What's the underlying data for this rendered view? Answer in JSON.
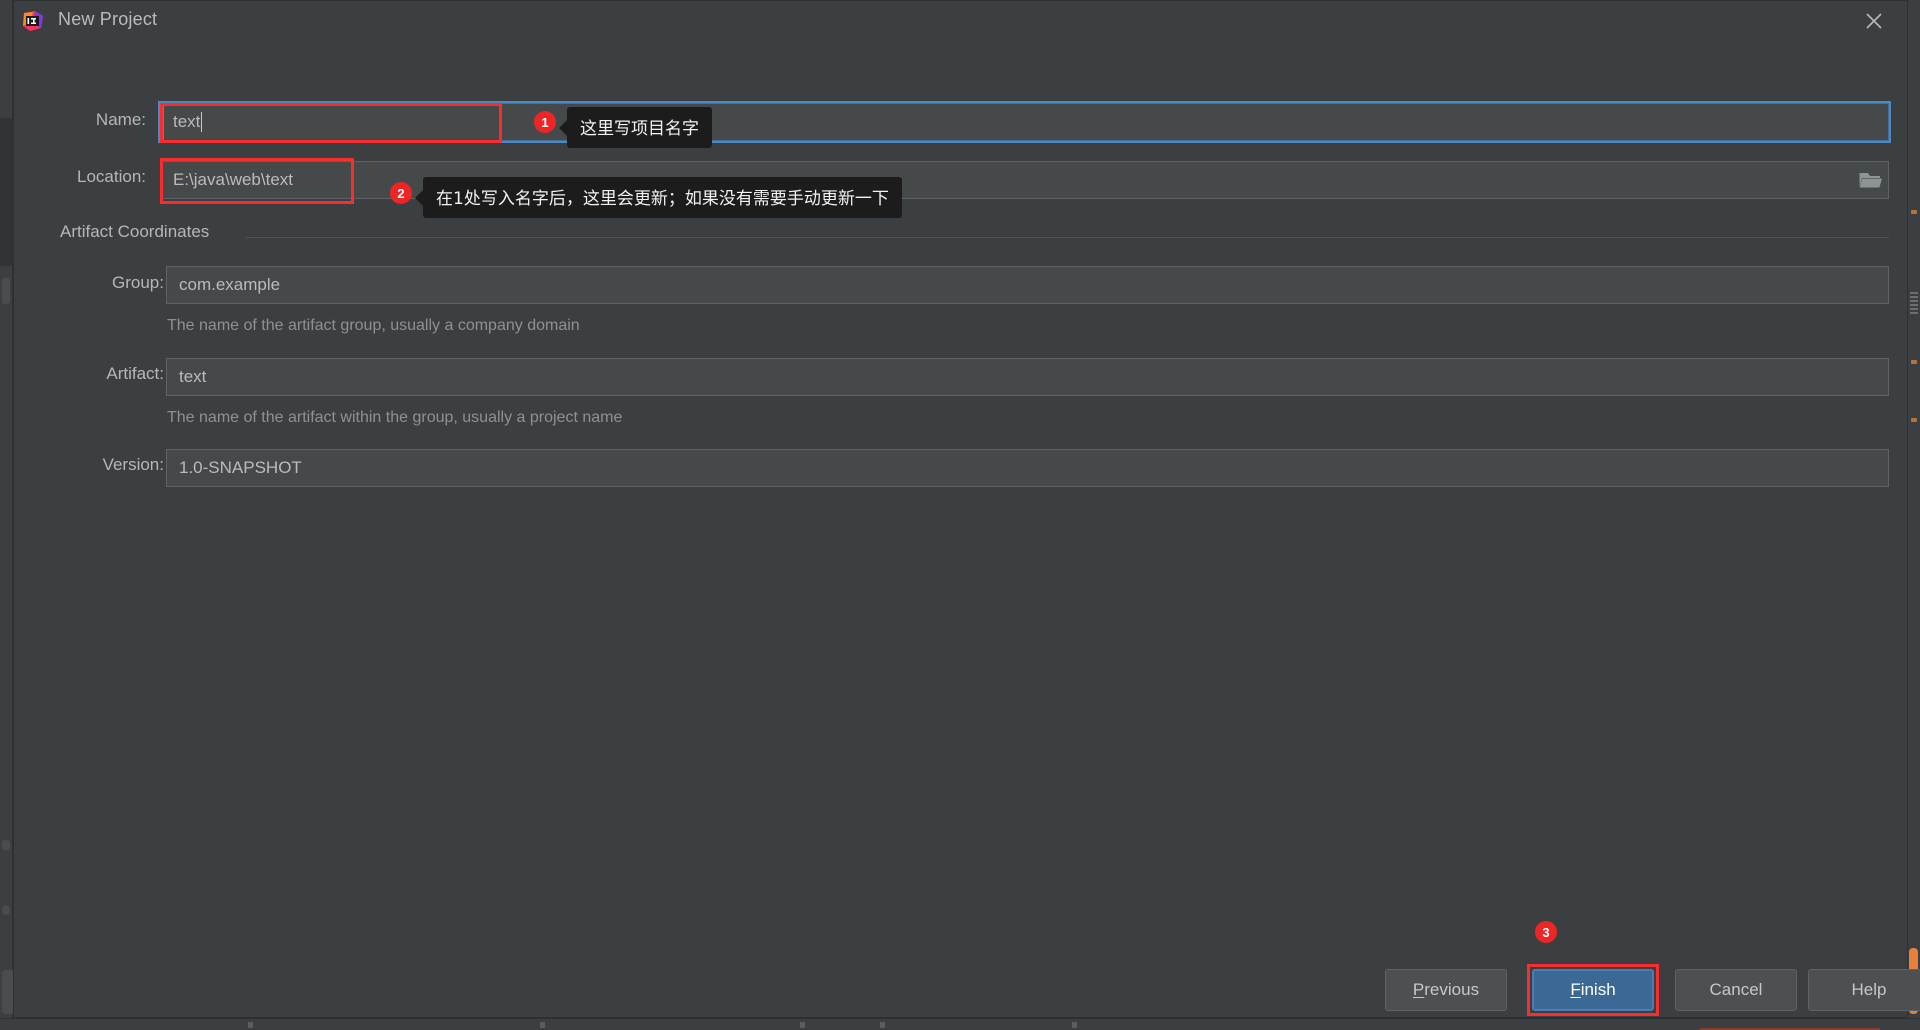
{
  "window": {
    "title": "New Project",
    "app_icon": "intellij-idea-icon",
    "close_icon": "close-icon"
  },
  "form": {
    "name": {
      "label": "Name:",
      "value": "text",
      "focused": true
    },
    "location": {
      "label": "Location:",
      "value": "E:\\java\\web\\text",
      "browse_icon": "folder-icon"
    }
  },
  "artifact_coordinates": {
    "section_title": "Artifact Coordinates",
    "group": {
      "label": "Group:",
      "value": "com.example",
      "hint": "The name of the artifact group, usually a company domain"
    },
    "artifact": {
      "label": "Artifact:",
      "value": "text",
      "hint": "The name of the artifact within the group, usually a project name"
    },
    "version": {
      "label": "Version:",
      "value": "1.0-SNAPSHOT"
    }
  },
  "annotations": [
    {
      "badge": "1",
      "text": "这里写项目名字"
    },
    {
      "badge": "2",
      "text": "在1处写入名字后，这里会更新；如果没有需要手动更新一下"
    },
    {
      "badge": "3",
      "text": ""
    }
  ],
  "footer": {
    "previous": {
      "prefix": "P",
      "rest": "revious"
    },
    "finish": {
      "prefix": "F",
      "rest": "inish"
    },
    "cancel": "Cancel",
    "help": "Help"
  },
  "colors": {
    "dialog_bg": "#3c3f41",
    "field_bg": "#45494a",
    "accent_focus": "#4a88c7",
    "annotation_red": "#fb2c2c",
    "badge_red": "#ee2525",
    "primary_button": "#3c6896",
    "scrollbar_orange": "#e8803a"
  }
}
